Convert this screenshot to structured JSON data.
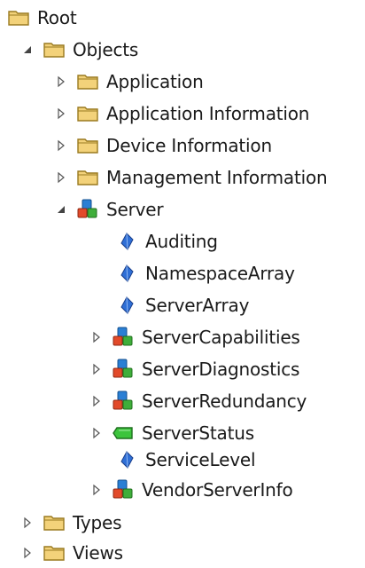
{
  "tree": {
    "root": {
      "label": "Root",
      "icon": "folder-icon"
    },
    "objects": {
      "label": "Objects",
      "icon": "folder-icon",
      "expanded": true
    },
    "application": {
      "label": "Application",
      "icon": "folder-icon",
      "expanded": false
    },
    "application_information": {
      "label": "Application Information",
      "icon": "folder-icon",
      "expanded": false
    },
    "device_information": {
      "label": "Device Information",
      "icon": "folder-icon",
      "expanded": false
    },
    "management_information": {
      "label": "Management Information",
      "icon": "folder-icon",
      "expanded": false
    },
    "server": {
      "label": "Server",
      "icon": "object-cubes-icon",
      "expanded": true
    },
    "auditing": {
      "label": "Auditing",
      "icon": "variable-icon"
    },
    "namespace_array": {
      "label": "NamespaceArray",
      "icon": "variable-icon"
    },
    "server_array": {
      "label": "ServerArray",
      "icon": "variable-icon"
    },
    "server_capabilities": {
      "label": "ServerCapabilities",
      "icon": "object-cubes-icon",
      "expanded": false
    },
    "server_diagnostics": {
      "label": "ServerDiagnostics",
      "icon": "object-cubes-icon",
      "expanded": false
    },
    "server_redundancy": {
      "label": "ServerRedundancy",
      "icon": "object-cubes-icon",
      "expanded": false
    },
    "server_status": {
      "label": "ServerStatus",
      "icon": "structure-variable-icon",
      "expanded": false
    },
    "service_level": {
      "label": "ServiceLevel",
      "icon": "variable-icon"
    },
    "vendor_server_info": {
      "label": "VendorServerInfo",
      "icon": "object-cubes-icon",
      "expanded": false
    },
    "types": {
      "label": "Types",
      "icon": "folder-icon",
      "expanded": false
    },
    "views": {
      "label": "Views",
      "icon": "folder-icon",
      "expanded": false
    }
  },
  "colors": {
    "folder_fill": "#f3d27a",
    "folder_stroke": "#9a7a20",
    "variable_blue": "#2f6fd6",
    "cube_red": "#e24a2a",
    "cube_green": "#3fae3a",
    "cube_blue": "#2a7fd4",
    "structure_green": "#3cc43c",
    "arrow_color": "#444444"
  }
}
